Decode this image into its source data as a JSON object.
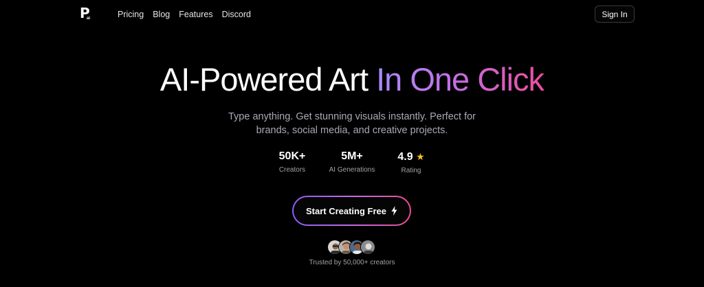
{
  "logo": {
    "mark": "P",
    "sub": "ai"
  },
  "nav": {
    "links": [
      "Pricing",
      "Blog",
      "Features",
      "Discord"
    ],
    "signin_label": "Sign In"
  },
  "hero": {
    "title_plain": "AI-Powered Art",
    "title_gradient": "In One Click",
    "subtitle": "Type anything. Get stunning visuals instantly. Perfect for brands, social media, and creative projects."
  },
  "stats": [
    {
      "value": "50K+",
      "label": "Creators"
    },
    {
      "value": "5M+",
      "label": "AI Generations"
    },
    {
      "value": "4.9",
      "label": "Rating",
      "icon": "star-icon"
    }
  ],
  "cta": {
    "label": "Start Creating Free",
    "icon": "lightning-icon"
  },
  "trust": {
    "text": "Trusted by 50,000+ creators",
    "avatar_count": 4
  },
  "colors": {
    "background": "#000000",
    "gradient_start": "#a88cf6",
    "gradient_mid": "#c46fe6",
    "gradient_end": "#ea4f9c",
    "star": "#f6c12b",
    "muted_text": "#a9a9b4"
  }
}
